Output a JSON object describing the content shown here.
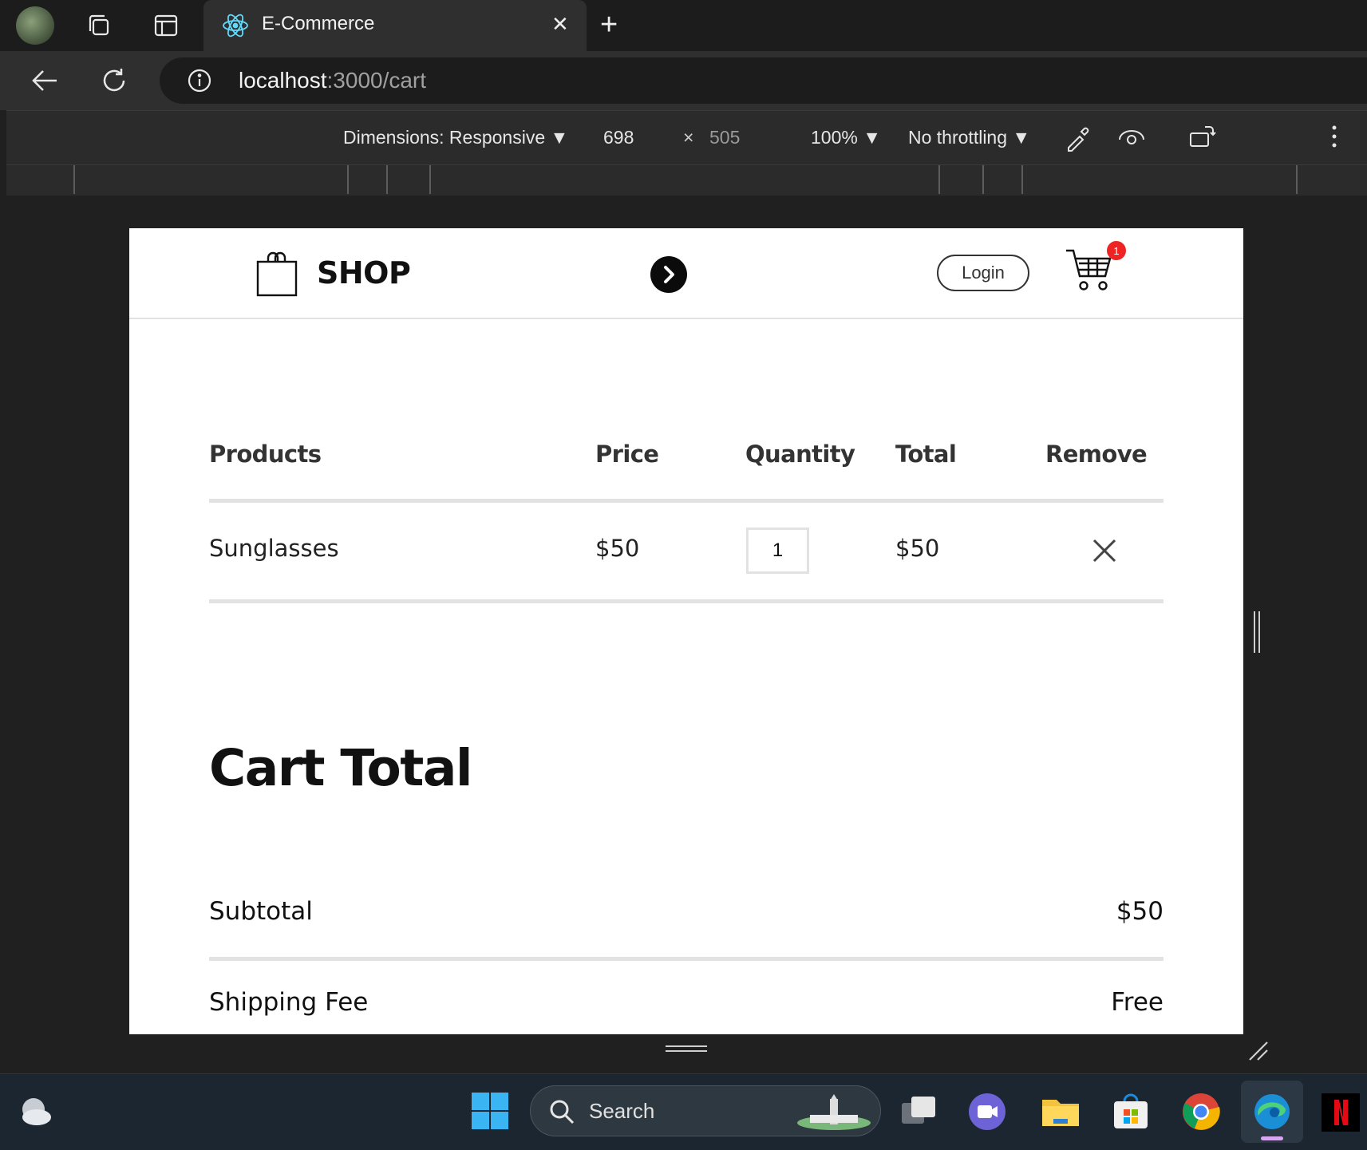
{
  "browser": {
    "tab_title": "E-Commerce",
    "url_host": "localhost",
    "url_rest": ":3000/cart"
  },
  "devtools": {
    "dimensions_label": "Dimensions: Responsive",
    "width": "698",
    "times": "×",
    "height": "505",
    "zoom": "100%",
    "throttling": "No throttling"
  },
  "page": {
    "brand": "SHOP",
    "login_label": "Login",
    "cart_count": "1",
    "table": {
      "headers": [
        "Products",
        "Price",
        "Quantity",
        "Total",
        "Remove"
      ],
      "rows": [
        {
          "product": "Sunglasses",
          "price": "$50",
          "quantity": "1",
          "total": "$50"
        }
      ]
    },
    "cart_total": {
      "title": "Cart Total",
      "subtotal_label": "Subtotal",
      "subtotal_value": "$50",
      "shipping_label": "Shipping Fee",
      "shipping_value": "Free"
    }
  },
  "taskbar": {
    "search_label": "Search"
  },
  "colors": {
    "badge": "#ee2424",
    "divider": "#e2e2e2"
  }
}
